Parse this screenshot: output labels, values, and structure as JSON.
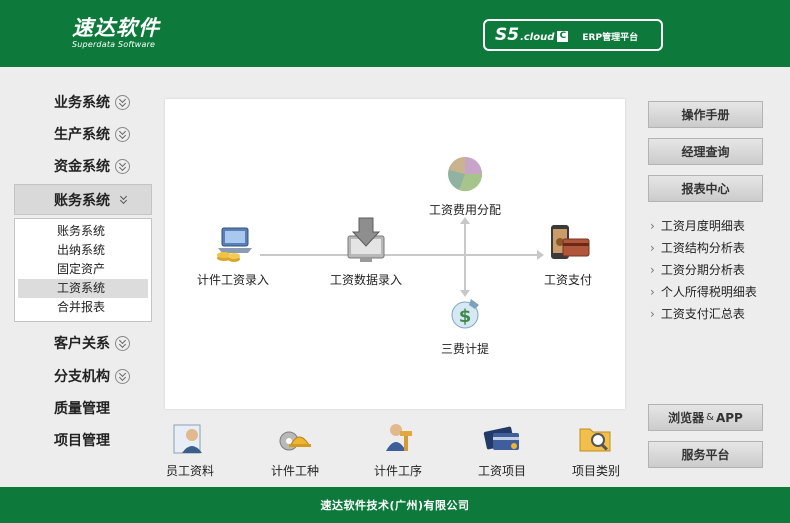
{
  "header": {
    "logo_cn": "速达软件",
    "logo_en": "Superdata Software",
    "platform_s5": "S5",
    "platform_cloud": ".cloud",
    "platform_c": "C",
    "platform_erp": "ERP管理平台"
  },
  "nav": {
    "items_top": [
      {
        "label": "业务系统"
      },
      {
        "label": "生产系统"
      },
      {
        "label": "资金系统"
      }
    ],
    "active": {
      "label": "账务系统"
    },
    "submenu": [
      "账务系统",
      "出纳系统",
      "固定资产",
      "工资系统",
      "合并报表"
    ],
    "submenu_selected": "工资系统",
    "items_bottom": [
      {
        "label": "客户关系"
      },
      {
        "label": "分支机构"
      },
      {
        "label": "质量管理"
      },
      {
        "label": "项目管理"
      }
    ]
  },
  "flow": {
    "piecework_entry": "计件工资录入",
    "salary_data_entry": "工资数据录入",
    "cost_allocation": "工资费用分配",
    "salary_payment": "工资支付",
    "three_fees": "三费计提"
  },
  "bottom": [
    "员工资料",
    "计件工种",
    "计件工序",
    "工资项目",
    "项目类别"
  ],
  "right": {
    "manual": "操作手册",
    "manager_query": "经理查询",
    "report_center": "报表中心",
    "reports": [
      "工资月度明细表",
      "工资结构分析表",
      "工资分期分析表",
      "个人所得税明细表",
      "工资支付汇总表"
    ],
    "browser": "浏览器",
    "browser_amp": "&",
    "browser_app": "APP",
    "service": "服务平台"
  },
  "footer": "速达软件技术(广州)有限公司",
  "colors": {
    "brand_green": "#0d7a3c",
    "panel_bg": "#ffffff",
    "page_bg": "#ededed"
  }
}
